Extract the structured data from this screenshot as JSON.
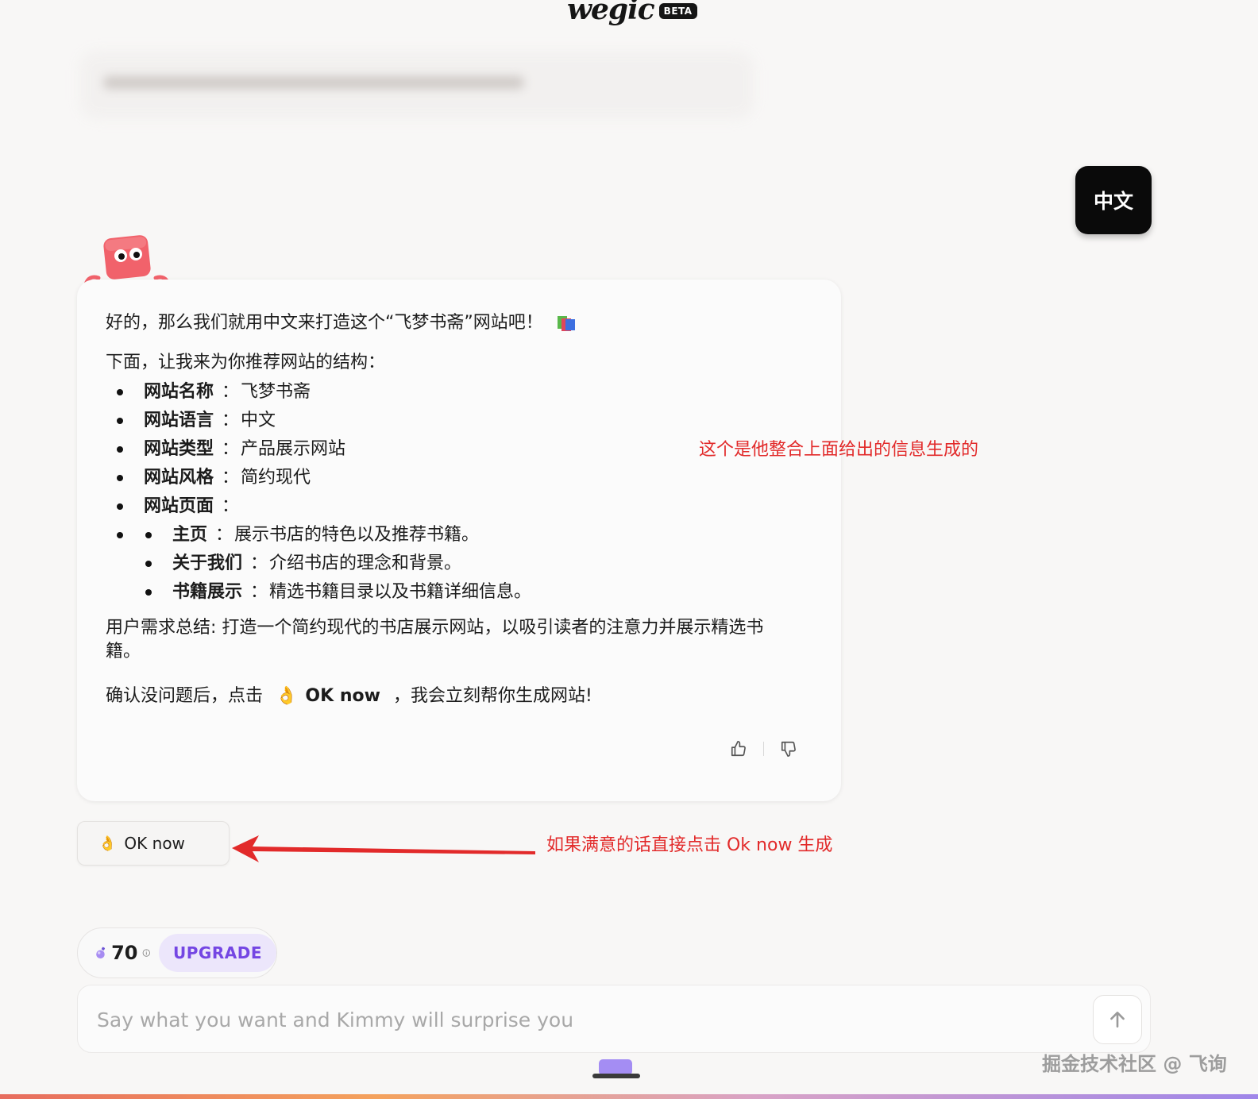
{
  "header": {
    "logo_text": "wegic",
    "badge": "BETA"
  },
  "language_chip": "中文",
  "message": {
    "line1": "好的，那么我们就用中文来打造这个“飞梦书斋”网站吧！",
    "line1_icon": "book-icon",
    "intro": "下面，让我来为你推荐网站的结构：",
    "items": [
      {
        "key": "网站名称",
        "sep": "：",
        "value": "飞梦书斋"
      },
      {
        "key": "网站语言",
        "sep": "：",
        "value": "中文"
      },
      {
        "key": "网站类型",
        "sep": "：",
        "value": "产品展示网站"
      },
      {
        "key": "网站风格",
        "sep": "：",
        "value": "简约现代"
      },
      {
        "key": "网站页面",
        "sep": "：",
        "value": ""
      }
    ],
    "pages": [
      {
        "key": "主页",
        "sep": "：",
        "value": "展示书店的特色以及推荐书籍。"
      },
      {
        "key": "关于我们",
        "sep": "：",
        "value": "介绍书店的理念和背景。"
      },
      {
        "key": "书籍展示",
        "sep": "：",
        "value": "精选书籍目录以及书籍详细信息。"
      }
    ],
    "summary": "用户需求总结: 打造一个简约现代的书店展示网站，以吸引读者的注意力并展示精选书籍。",
    "confirm_pre": "确认没问题后，点击",
    "confirm_emoji": "👌",
    "confirm_ok": "OK now",
    "confirm_post": "，我会立刻帮你生成网站!"
  },
  "ok_button": {
    "emoji": "👌",
    "label": "OK now"
  },
  "annotations": {
    "note1": "这个是他整合上面给出的信息生成的",
    "note2": "如果满意的话直接点击 Ok now 生成",
    "color": "#e22a2a"
  },
  "credits": {
    "count": "70",
    "upgrade": "UPGRADE"
  },
  "input": {
    "placeholder": "Say what you want and Kimmy will surprise you"
  },
  "watermark": "掘金技术社区 @ 飞询",
  "colors": {
    "accent": "#7446e3",
    "mascot": "#f1626b",
    "annotation": "#e22a2a"
  }
}
